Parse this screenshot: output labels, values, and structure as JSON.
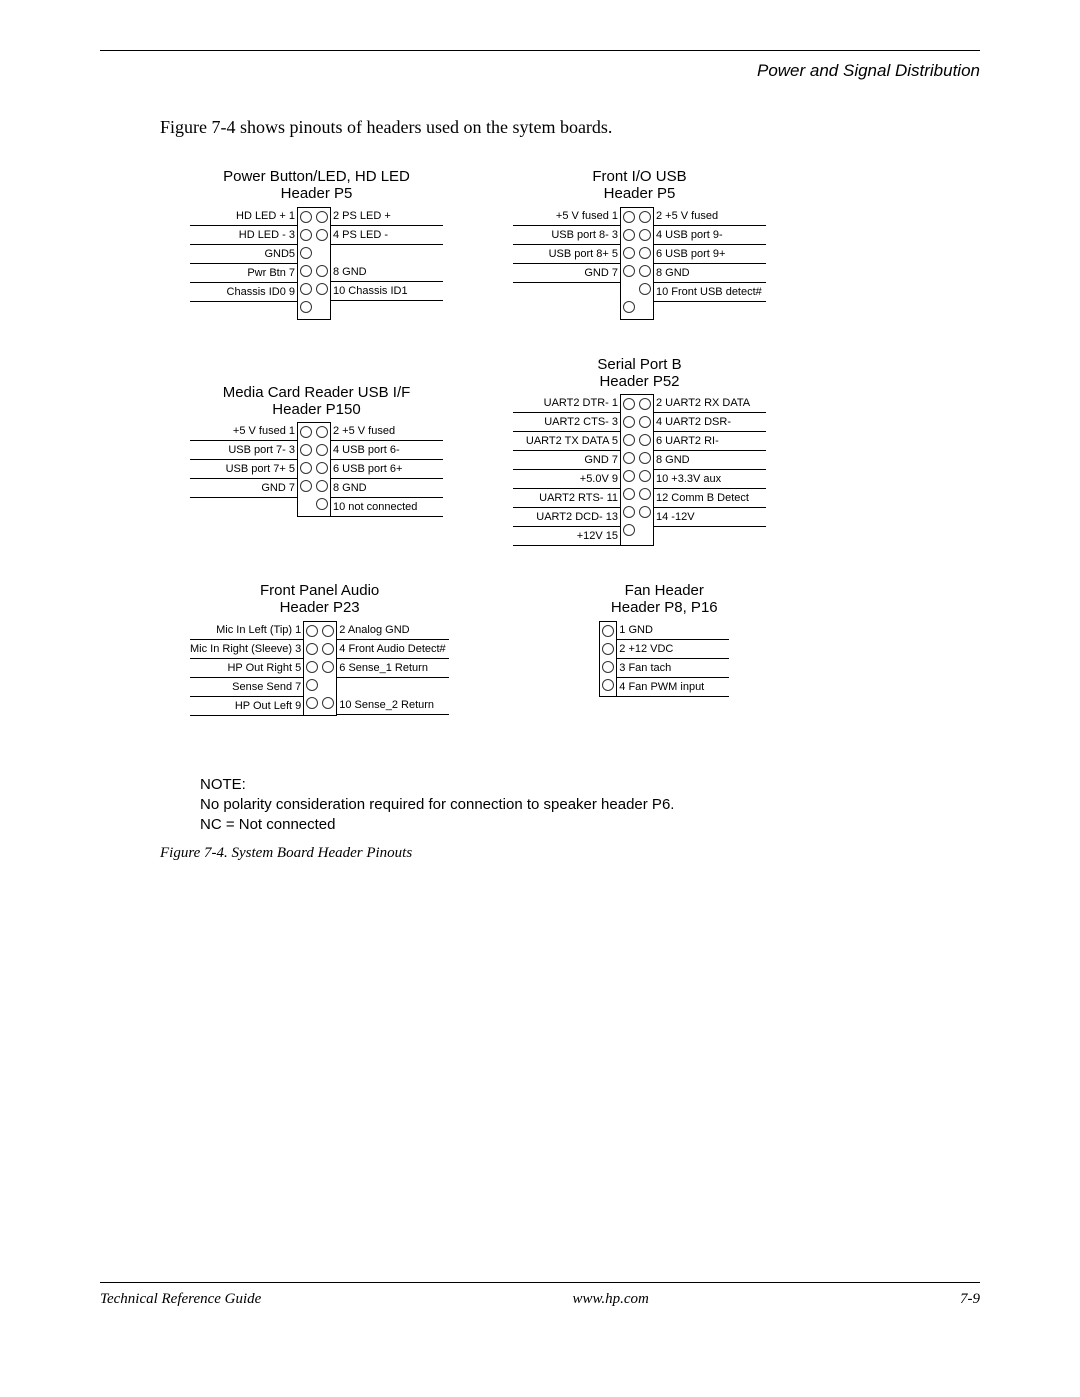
{
  "doc": {
    "section_title": "Power and Signal Distribution",
    "intro": "Figure 7-4 shows pinouts of headers used on the sytem boards.",
    "note_label": "NOTE:",
    "note_body_1": "No polarity consideration required for connection to speaker header P6.",
    "note_body_2": "NC = Not connected",
    "figure_caption": "Figure 7-4.   System Board Header Pinouts",
    "footer_left": "Technical Reference Guide",
    "footer_center": "www.hp.com",
    "footer_right": "7-9"
  },
  "headers": {
    "power_led": {
      "title": "Power Button/LED, HD LED\nHeader P5",
      "left": [
        "HD LED + 1",
        "HD LED - 3",
        "GND5",
        "Pwr Btn 7",
        "Chassis ID0 9",
        ""
      ],
      "right": [
        "2 PS LED +",
        "4 PS LED -",
        "",
        "8 GND",
        "10 Chassis ID1",
        ""
      ],
      "rows": 6,
      "key_right": [
        2,
        5
      ],
      "key_left": []
    },
    "front_usb": {
      "title": "Front I/O USB\nHeader P5",
      "left": [
        "+5 V fused 1",
        "USB port 8- 3",
        "USB port 8+ 5",
        "GND 7",
        "",
        ""
      ],
      "right": [
        "2 +5 V fused",
        "4 USB port 9-",
        "6 USB port 9+",
        "8 GND",
        "10 Front USB detect#",
        ""
      ],
      "rows": 6,
      "key_right": [
        5
      ],
      "key_left": [
        4
      ]
    },
    "media_card": {
      "title": "Media Card Reader USB I/F\nHeader P150",
      "left": [
        "+5 V fused 1",
        "USB port 7- 3",
        "USB port 7+ 5",
        "GND 7",
        ""
      ],
      "right": [
        "2 +5 V fused",
        "4 USB port 6-",
        "6 USB port 6+",
        "8 GND",
        "10 not connected"
      ],
      "rows": 5,
      "key_right": [],
      "key_left": [
        4
      ]
    },
    "serial_b": {
      "title": "Serial Port B\nHeader P52",
      "left": [
        "UART2 DTR- 1",
        "UART2 CTS- 3",
        "UART2 TX DATA 5",
        "GND 7",
        "+5.0V 9",
        "UART2 RTS- 11",
        "UART2 DCD- 13",
        "+12V 15"
      ],
      "right": [
        "2 UART2 RX DATA",
        "4 UART2 DSR-",
        "6 UART2 RI-",
        "8 GND",
        "10 +3.3V aux",
        "12 Comm B Detect",
        "14 -12V",
        ""
      ],
      "rows": 8,
      "key_right": [
        7
      ],
      "key_left": []
    },
    "front_audio": {
      "title": "Front Panel Audio\nHeader P23",
      "left": [
        "Mic In Left (Tip) 1",
        "Mic In Right (Sleeve) 3",
        "HP Out Right 5",
        "Sense Send 7",
        "HP Out Left 9"
      ],
      "right": [
        "2 Analog GND",
        "4 Front Audio Detect#",
        "6 Sense_1 Return",
        "",
        "10 Sense_2 Return"
      ],
      "rows": 5,
      "key_right": [
        3
      ],
      "key_left": []
    },
    "fan": {
      "title": "Fan Header\nHeader P8, P16",
      "right": [
        "1 GND",
        "2 +12 VDC",
        "3 Fan tach",
        "4 Fan PWM input"
      ],
      "rows": 4
    }
  }
}
